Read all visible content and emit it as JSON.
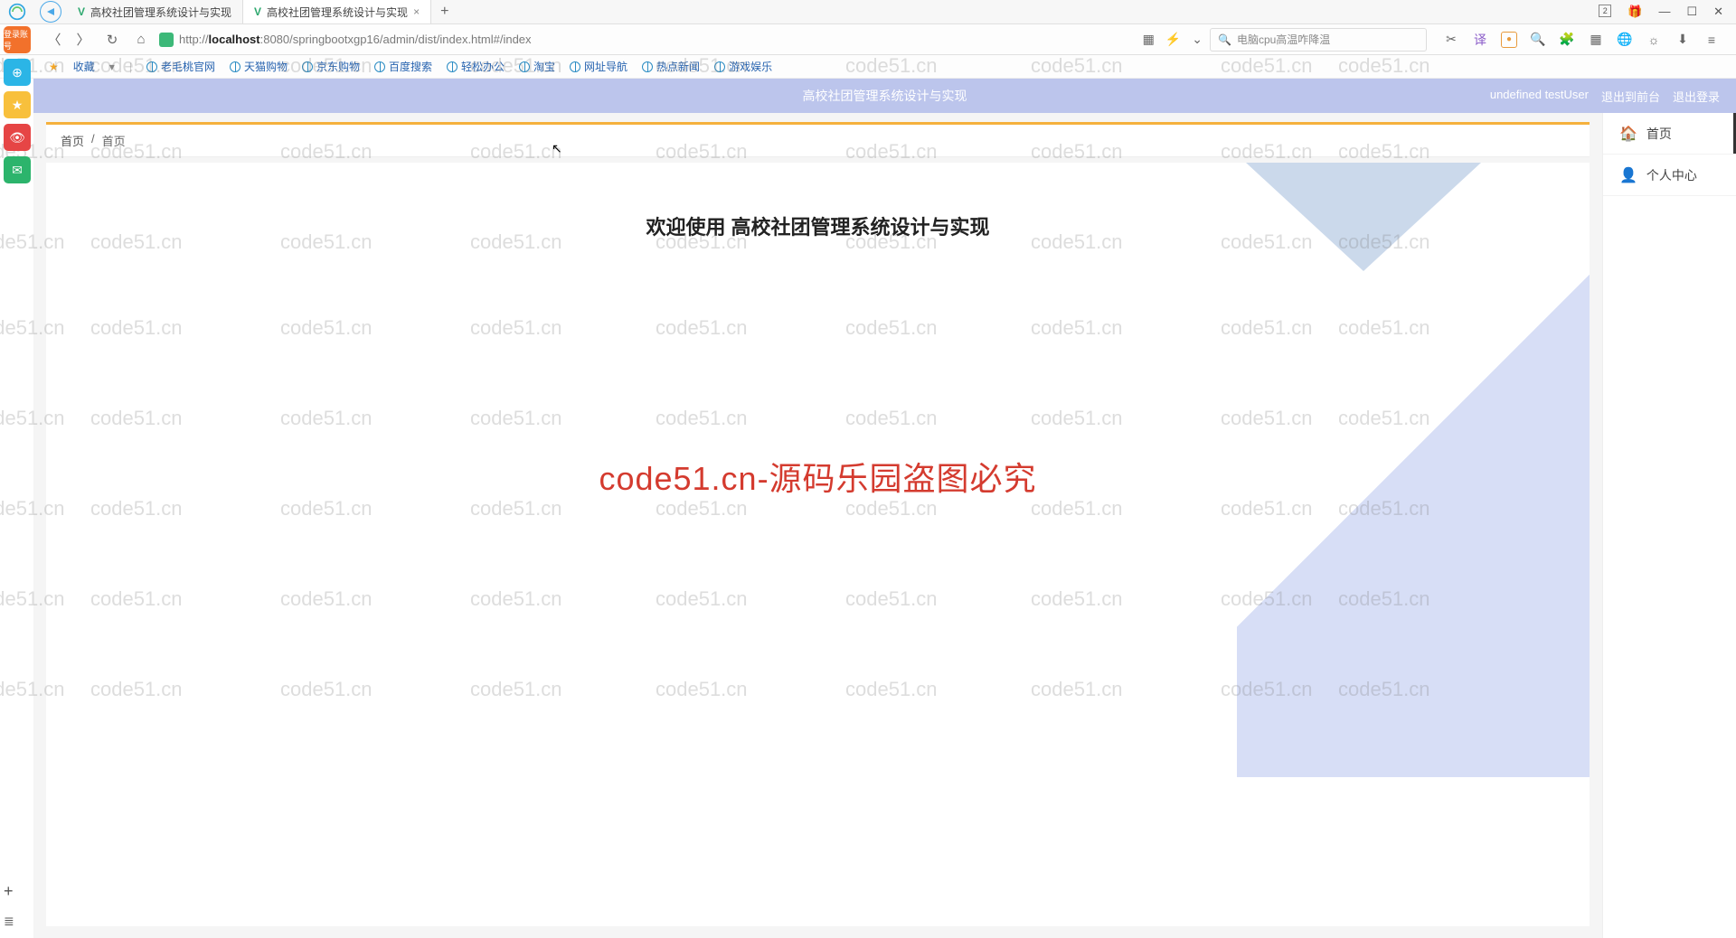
{
  "browser": {
    "tabs": [
      {
        "title": "高校社团管理系统设计与实现"
      },
      {
        "title": "高校社团管理系统设计与实现"
      }
    ],
    "url_prefix": "http://",
    "url_host": "localhost",
    "url_port": ":8080",
    "url_path": "/springbootxgp16/admin/dist/index.html#/index",
    "search_placeholder": "电脑cpu高温咋降温",
    "tab_count_badge": "2",
    "bookmarks_label": "收藏",
    "bookmarks": [
      "老毛桃官网",
      "天猫购物",
      "京东购物",
      "百度搜索",
      "轻松办公",
      "淘宝",
      "网址导航",
      "热点新闻",
      "游戏娱乐"
    ]
  },
  "side_badge": "登录账号",
  "app": {
    "header_title": "高校社团管理系统设计与实现",
    "user_label": "undefined testUser",
    "exit_front": "退出到前台",
    "exit_login": "退出登录",
    "breadcrumb_home": "首页",
    "breadcrumb_sep": "/",
    "breadcrumb_current": "首页",
    "welcome_text": "欢迎使用 高校社团管理系统设计与实现",
    "right_nav": {
      "home": "首页",
      "profile": "个人中心"
    }
  },
  "watermark": {
    "text": "code51.cn",
    "big": "code51.cn-源码乐园盗图必究"
  }
}
